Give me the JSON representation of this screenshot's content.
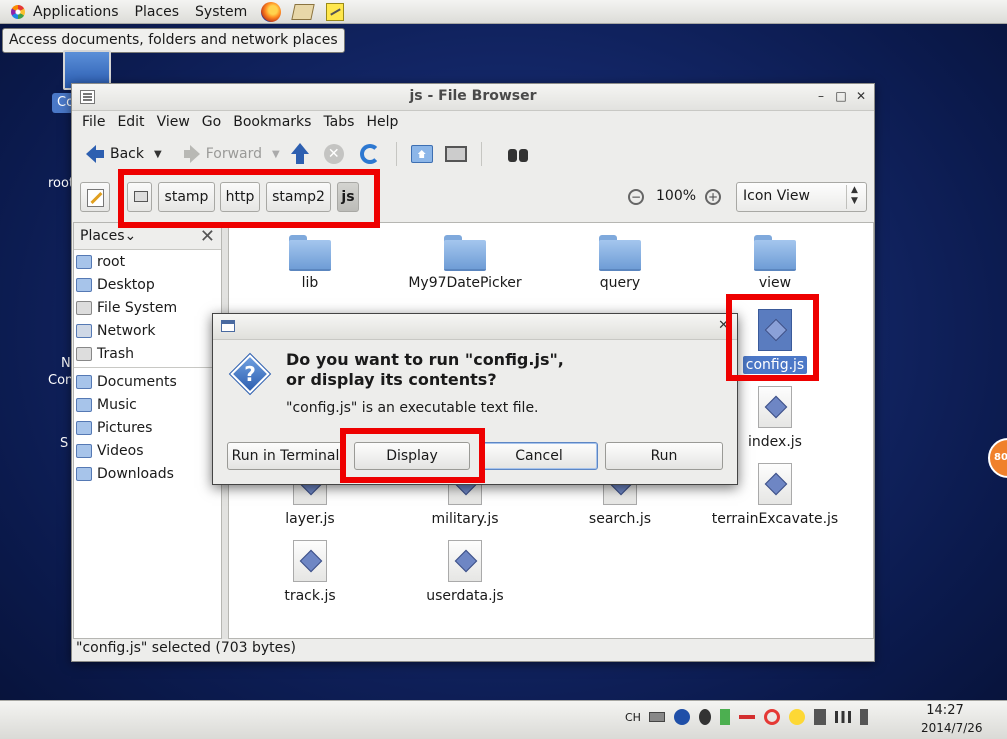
{
  "top_panel": {
    "menus": [
      "Applications",
      "Places",
      "System"
    ],
    "launchers": [
      "firefox-icon",
      "mail-icon",
      "notes-icon"
    ]
  },
  "tooltip": "Access documents, folders and network places",
  "desktop": {
    "selected_label": "Co",
    "peeks": [
      "root",
      "N",
      "Con",
      "S"
    ]
  },
  "side_badge": "80",
  "window": {
    "title": "js - File Browser",
    "menu": [
      "File",
      "Edit",
      "View",
      "Go",
      "Bookmarks",
      "Tabs",
      "Help"
    ],
    "toolbar": {
      "back": "Back",
      "forward": "Forward"
    },
    "breadcrumbs": [
      "stamp",
      "http",
      "stamp2",
      "js"
    ],
    "zoom": "100%",
    "view_mode": "Icon View",
    "places_header": "Places",
    "places": [
      {
        "label": "root",
        "icon": "home-folder-icon"
      },
      {
        "label": "Desktop",
        "icon": "desktop-icon"
      },
      {
        "label": "File System",
        "icon": "drive-icon"
      },
      {
        "label": "Network",
        "icon": "network-icon"
      },
      {
        "label": "Trash",
        "icon": "trash-icon"
      }
    ],
    "bookmarks": [
      "Documents",
      "Music",
      "Pictures",
      "Videos",
      "Downloads"
    ],
    "files": [
      "lib",
      "My97DatePicker",
      "query",
      "view",
      "config.js",
      "index.js",
      "layer.js",
      "military.js",
      "search.js",
      "terrainExcavate.js",
      "track.js",
      "userdata.js"
    ],
    "status": "\"config.js\" selected (703 bytes)"
  },
  "dialog": {
    "question_line1": "Do you want to run \"config.js\",",
    "question_line2": "or display its contents?",
    "detail": "\"config.js\" is an executable text file.",
    "buttons": [
      "Run in Terminal",
      "Display",
      "Cancel",
      "Run"
    ]
  },
  "tray": {
    "lang": "CH"
  },
  "clock": {
    "time": "14:27",
    "date": "2014/7/26"
  },
  "colors": {
    "highlight": "#ee0000",
    "selection": "#4c78c7",
    "desktop": "#14286a"
  }
}
